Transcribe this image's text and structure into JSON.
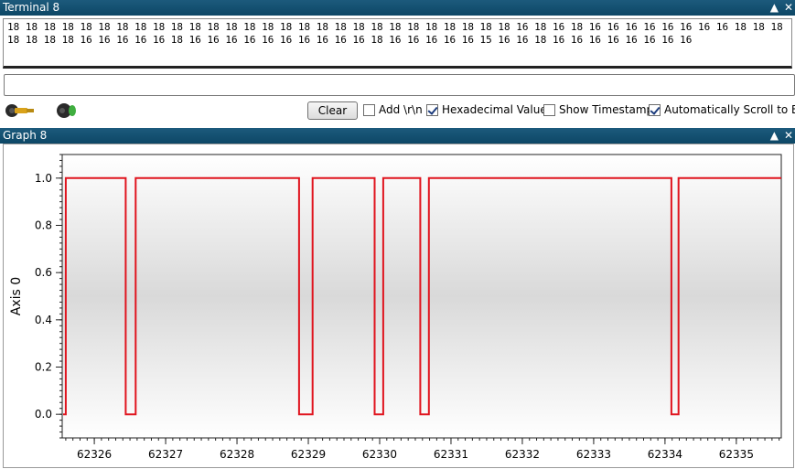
{
  "terminal": {
    "title": "Terminal 8",
    "content": "18 18 18 18 18 18 18 18 18 18 18 18 18 18 18 18 18 18 18 18 18 18 18 18 18 18 18 18 16 18 16 18 16 16 16 16 16 16 16 16 18 18 18 18 18 18 18 16 16 16 16 16 18 16 16 16 16 16 16 16 16 16 16 18 16 16 16 16 16 15 16 16 18 16 16 16 16 16 16 16 16",
    "send_value": "",
    "send_placeholder": "",
    "clear_label": "Clear",
    "options": [
      {
        "label": "Add \\r\\n",
        "checked": false
      },
      {
        "label": "Hexadecimal Values",
        "checked": true
      },
      {
        "label": "Show Timestamp",
        "checked": false
      },
      {
        "label": "Automatically Scroll to End",
        "checked": true
      }
    ]
  },
  "window_controls": {
    "collapse": "▲",
    "close": "✕"
  },
  "icons": {
    "connect": "plug-connected-icon",
    "disconnect": "plug-disconnected-icon"
  },
  "graph": {
    "title": "Graph 8"
  },
  "colors": {
    "title_bar": "#0d4766",
    "signal": "#e0141e",
    "plot_band": "#d9d9d9"
  },
  "chart_data": {
    "type": "line",
    "title": "",
    "ylabel": "Axis 0",
    "xlabel": "",
    "xlim": [
      62325.55,
      62335.63
    ],
    "ylim": [
      -0.1,
      1.1
    ],
    "x_ticks": [
      62326,
      62327,
      62328,
      62329,
      62330,
      62331,
      62332,
      62333,
      62334,
      62335
    ],
    "y_ticks": [
      0.0,
      0.2,
      0.4,
      0.6,
      0.8,
      1.0
    ],
    "y_tick_labels": [
      "0.0",
      "0.2",
      "0.4",
      "0.6",
      "0.8",
      "1.0"
    ],
    "grid": false,
    "series": [
      {
        "x": [
          62325.55,
          62325.6,
          62325.6,
          62326.44,
          62326.44,
          62326.58,
          62326.58,
          62328.87,
          62328.87,
          62329.06,
          62329.06,
          62329.93,
          62329.93,
          62330.05,
          62330.05,
          62330.57,
          62330.57,
          62330.69,
          62330.69,
          62334.09,
          62334.09,
          62334.19,
          62334.19,
          62335.63
        ],
        "y": [
          0,
          0,
          1,
          1,
          0,
          0,
          1,
          1,
          0,
          0,
          1,
          1,
          0,
          0,
          1,
          1,
          0,
          0,
          1,
          1,
          0,
          0,
          1,
          1
        ]
      }
    ]
  }
}
